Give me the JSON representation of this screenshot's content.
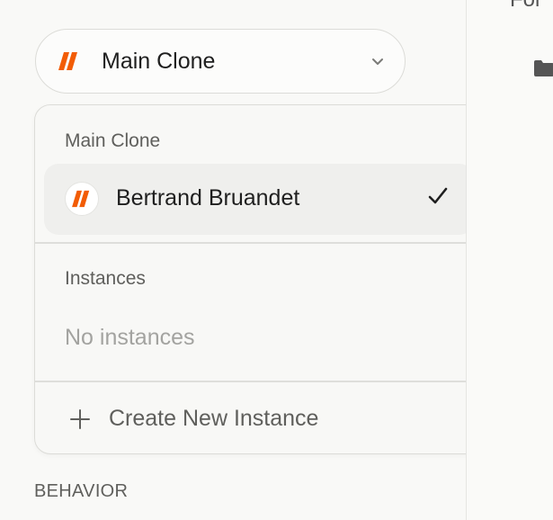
{
  "selector": {
    "label": "Main Clone",
    "chevron_icon": "chevron-down-icon"
  },
  "dropdown": {
    "main_section_title": "Main Clone",
    "main_item": {
      "name": "Bertrand Bruandet",
      "selected": true
    },
    "instances_section_title": "Instances",
    "instances_empty_text": "No instances",
    "create_label": "Create New Instance"
  },
  "sidebar": {
    "section_label": "BEHAVIOR"
  },
  "main": {
    "title_partial": "Fol"
  },
  "colors": {
    "brand_orange": "#f25c05",
    "check": "#1f1f1f"
  }
}
